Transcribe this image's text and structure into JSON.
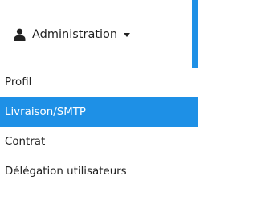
{
  "colors": {
    "accent": "#1e90e6",
    "text": "#222222",
    "active_text": "#ffffff"
  },
  "menu": {
    "label": "Administration",
    "icons": {
      "user": "user-icon",
      "caret": "caret-down-icon"
    },
    "items": [
      {
        "label": "Profil",
        "active": false
      },
      {
        "label": "Livraison/SMTP",
        "active": true
      },
      {
        "label": "Contrat",
        "active": false
      },
      {
        "label": "Délégation utilisateurs",
        "active": false
      }
    ]
  }
}
